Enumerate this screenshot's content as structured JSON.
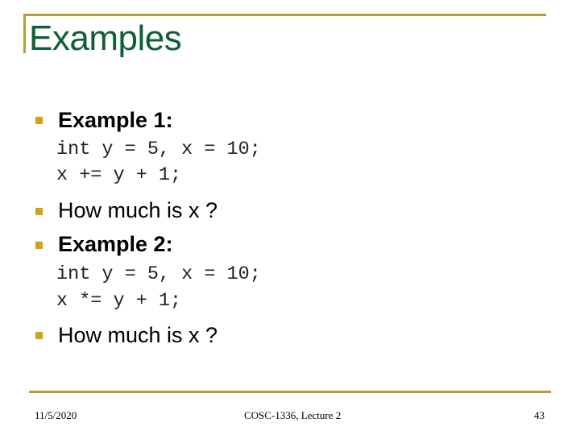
{
  "slide": {
    "title": "Examples",
    "accent_color": "#C39C2A",
    "title_color": "#0B6136",
    "bullet_color": "#D4A313",
    "items": [
      {
        "type": "bullet",
        "bold": true,
        "text": "Example 1:"
      },
      {
        "type": "code",
        "lines": [
          "int y = 5, x = 10;",
          "x += y + 1;"
        ]
      },
      {
        "type": "bullet",
        "bold": false,
        "text": "How much is x ?"
      },
      {
        "type": "bullet",
        "bold": true,
        "text": "Example 2:"
      },
      {
        "type": "code",
        "lines": [
          "int y = 5, x = 10;",
          "x *= y + 1;"
        ]
      },
      {
        "type": "bullet",
        "bold": false,
        "text": "How much is x ?"
      }
    ],
    "bullet_icon": "square-bullet-icon"
  },
  "footer": {
    "date": "11/5/2020",
    "center": "COSC-1336, Lecture 2",
    "page_number": "43"
  }
}
